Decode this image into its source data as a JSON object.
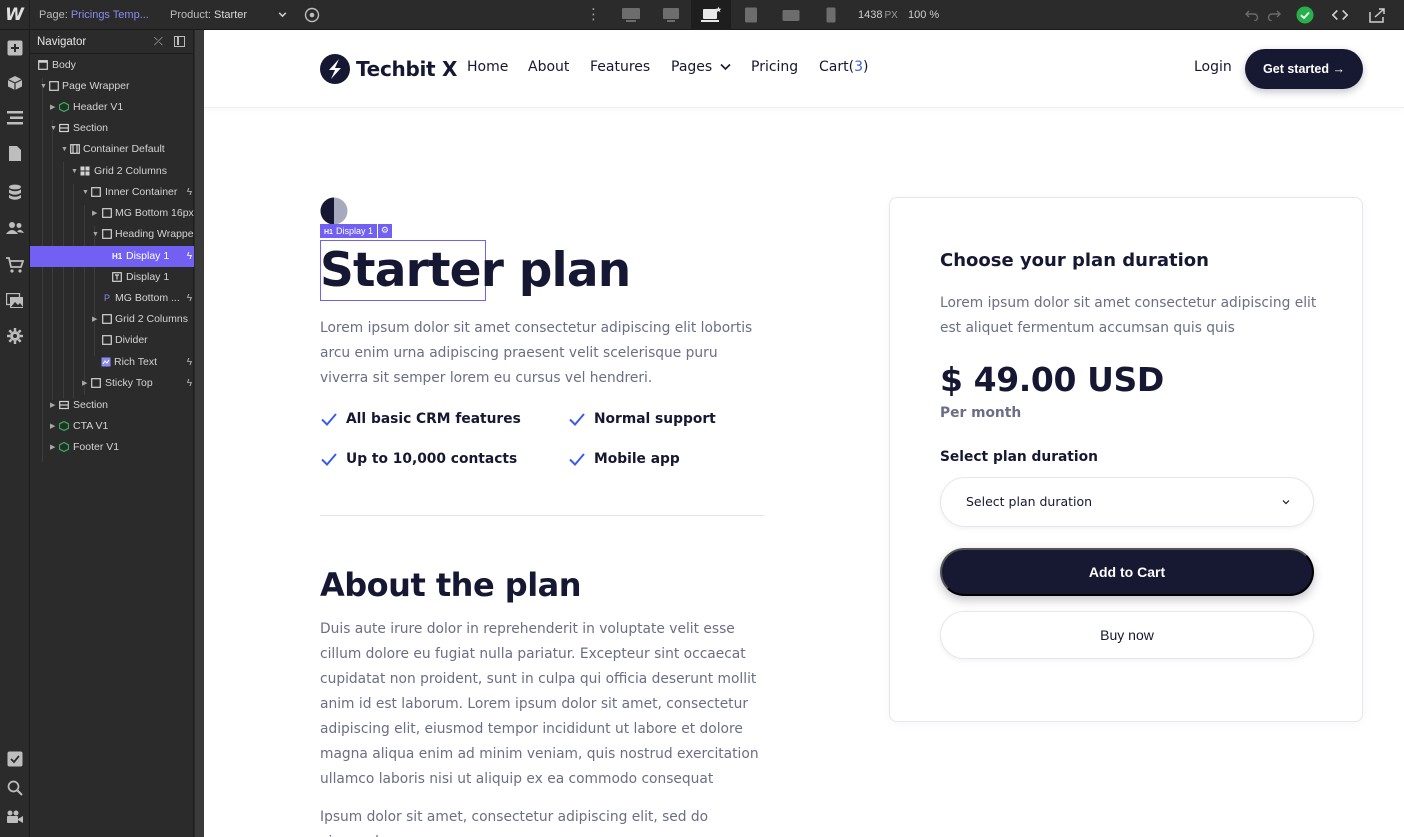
{
  "topbar": {
    "page_label": "Page:",
    "page_value": "Pricings Temp...",
    "product_label": "Product:",
    "product_value": "Starter",
    "canvas_width": "1438",
    "canvas_width_unit": "PX",
    "zoom": "100 %",
    "devices": [
      "desktop-large-icon",
      "desktop-icon",
      "laptop-base-icon",
      "tablet-icon",
      "tablet-landscape-icon",
      "phone-icon"
    ],
    "active_device": "laptop-base-icon",
    "status_color": "#27b14a"
  },
  "navigator": {
    "title": "Navigator",
    "tree": [
      {
        "label": "Body",
        "icon": "box-icon"
      },
      {
        "label": "Page Wrapper",
        "icon": "box-icon"
      },
      {
        "label": "Header V1",
        "icon": "component-icon"
      },
      {
        "label": "Section",
        "icon": "section-icon"
      },
      {
        "label": "Container Default",
        "icon": "container-icon"
      },
      {
        "label": "Grid 2 Columns",
        "icon": "grid-icon"
      },
      {
        "label": "Inner Container",
        "icon": "box-icon"
      },
      {
        "label": "MG Bottom 16px",
        "icon": "box-icon"
      },
      {
        "label": "Heading Wrapper",
        "icon": "box-icon"
      },
      {
        "label": "Display 1",
        "icon": "heading-icon",
        "selected": true
      },
      {
        "label": "Display 1",
        "icon": "text-icon"
      },
      {
        "label": "MG Bottom ...",
        "icon": "paragraph-icon"
      },
      {
        "label": "Grid 2 Columns",
        "icon": "box-icon"
      },
      {
        "label": "Divider",
        "icon": "box-icon"
      },
      {
        "label": "Rich Text",
        "icon": "rich-text-icon"
      },
      {
        "label": "Sticky Top",
        "icon": "box-icon"
      },
      {
        "label": "Section",
        "icon": "section-icon"
      },
      {
        "label": "CTA V1",
        "icon": "component-icon"
      },
      {
        "label": "Footer V1",
        "icon": "component-icon"
      }
    ]
  },
  "site": {
    "brand": "Techbit X",
    "nav": {
      "home": "Home",
      "about": "About",
      "features": "Features",
      "pages": "Pages",
      "pricing": "Pricing",
      "cart_label": "Cart(",
      "cart_count": "3",
      "cart_close": ")"
    },
    "login": "Login",
    "get_started": "Get started →"
  },
  "selection": {
    "tag_icon": "H1",
    "tag_label": "Display 1"
  },
  "hero": {
    "title_word1": "Starter",
    "title_word2": "plan",
    "description": "Lorem ipsum dolor sit amet consectetur adipiscing elit lobortis arcu enim urna adipiscing praesent velit scelerisque puru viverra sit semper lorem eu cursus vel hendreri.",
    "features": [
      "All basic CRM features",
      "Normal support",
      "Up to 10,000 contacts",
      "Mobile app"
    ]
  },
  "about": {
    "title": "About the plan",
    "p1": "Duis aute irure dolor in reprehenderit in voluptate velit esse cillum dolore eu fugiat nulla pariatur. Excepteur sint occaecat cupidatat non proident, sunt in culpa qui officia deserunt mollit anim id est laborum. Lorem ipsum dolor sit amet, consectetur adipiscing elit, eiusmod tempor incididunt ut labore et dolore magna aliqua enim ad minim veniam, quis nostrud exercitation ullamco laboris nisi ut aliquip ex ea commodo consequat",
    "p2": "Ipsum dolor sit amet, consectetur adipiscing elit, sed do eiusmod"
  },
  "card": {
    "title": "Choose your plan duration",
    "description": "Lorem ipsum dolor sit amet consectetur adipiscing elit est aliquet fermentum accumsan quis quis",
    "price": "$ 49.00 USD",
    "per": "Per month",
    "select_label": "Select plan duration",
    "select_value": "Select plan duration",
    "add_to_cart": "Add to Cart",
    "buy_now": "Buy now"
  },
  "colors": {
    "accent_purple": "#7160f2",
    "navy": "#171832",
    "link_blue": "#3d5ce8",
    "muted_text": "#6b6e85"
  }
}
